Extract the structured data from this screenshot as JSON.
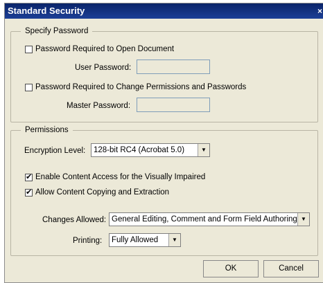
{
  "window": {
    "title": "Standard Security",
    "close_glyph": "×"
  },
  "specify_password": {
    "heading": "Specify Password",
    "open_doc": {
      "label": "Password Required to Open Document",
      "checked": false
    },
    "user_password": {
      "label": "User Password:",
      "value": ""
    },
    "change_perms": {
      "label": "Password Required to Change Permissions and Passwords",
      "checked": false
    },
    "master_password": {
      "label": "Master Password:",
      "value": ""
    }
  },
  "permissions": {
    "heading": "Permissions",
    "encryption": {
      "label": "Encryption Level:",
      "value": "128-bit RC4 (Acrobat 5.0)"
    },
    "visually_impaired": {
      "label": "Enable Content Access for the Visually Impaired",
      "checked": true
    },
    "copying": {
      "label": "Allow Content Copying and Extraction",
      "checked": true
    },
    "changes_allowed": {
      "label": "Changes Allowed:",
      "value": "General Editing, Comment and Form Field Authoring"
    },
    "printing": {
      "label": "Printing:",
      "value": "Fully Allowed"
    }
  },
  "buttons": {
    "ok": "OK",
    "cancel": "Cancel"
  },
  "checkmark": "✔",
  "dropdown_arrow": "▼"
}
